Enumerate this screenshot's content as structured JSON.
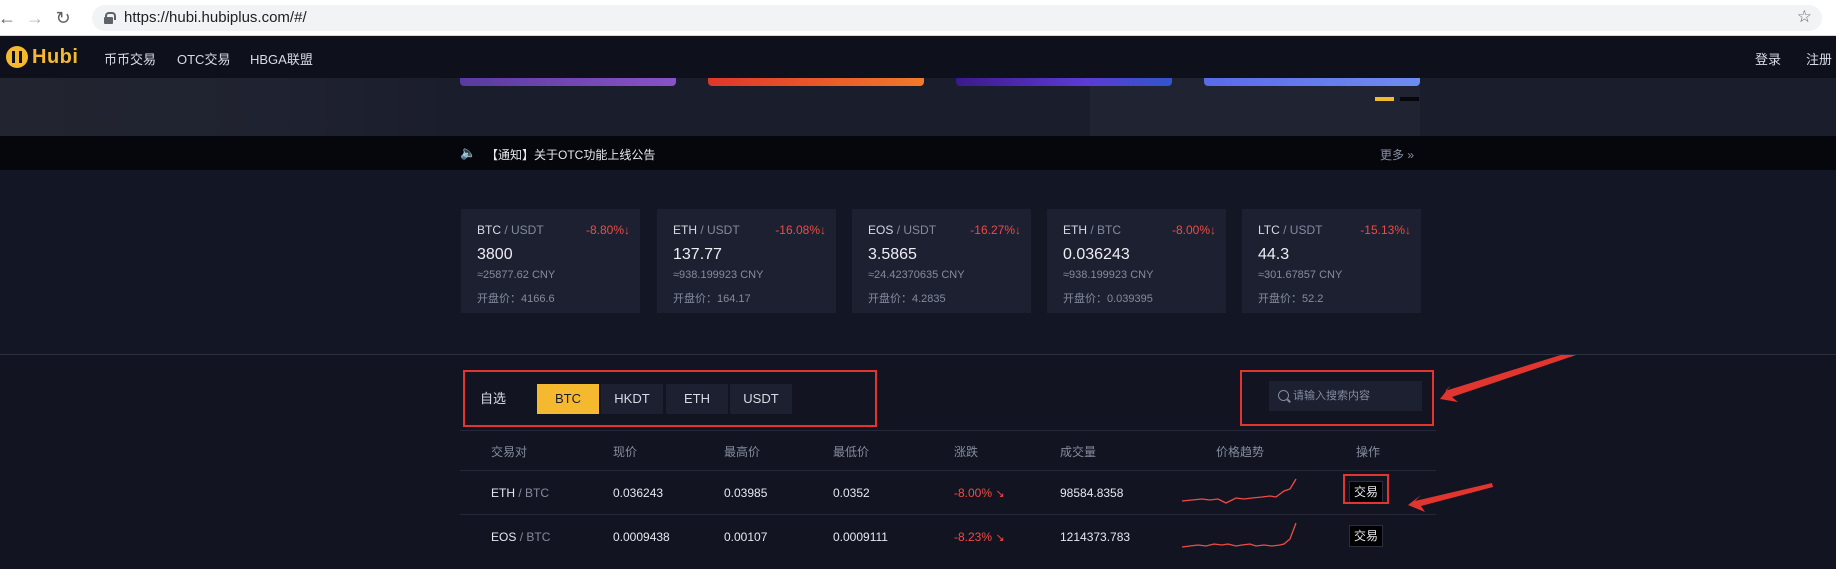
{
  "browser": {
    "url": "https://hubi.hubiplus.com/#/",
    "back_icon": "arrow-left-icon",
    "forward_icon": "arrow-right-icon",
    "reload_icon": "reload-icon",
    "bookmark_icon": "star-icon"
  },
  "header": {
    "logo": "Hubi",
    "nav": [
      "币币交易",
      "OTC交易",
      "HBGA联盟"
    ],
    "login": "登录",
    "register": "注册"
  },
  "notice": {
    "text": "【通知】关于OTC功能上线公告",
    "more": "更多"
  },
  "tickers": [
    {
      "base": "BTC",
      "quote": "/ USDT",
      "change": "-8.80%",
      "price": "3800",
      "cny": "≈25877.62 CNY",
      "open": "开盘价：4166.6"
    },
    {
      "base": "ETH",
      "quote": "/ USDT",
      "change": "-16.08%",
      "price": "137.77",
      "cny": "≈938.199923 CNY",
      "open": "开盘价：164.17"
    },
    {
      "base": "EOS",
      "quote": "/ USDT",
      "change": "-16.27%",
      "price": "3.5865",
      "cny": "≈24.42370635 CNY",
      "open": "开盘价：4.2835"
    },
    {
      "base": "ETH",
      "quote": "/ BTC",
      "change": "-8.00%",
      "price": "0.036243",
      "cny": "≈938.199923 CNY",
      "open": "开盘价：0.039395"
    },
    {
      "base": "LTC",
      "quote": "/ USDT",
      "change": "-15.13%",
      "price": "44.3",
      "cny": "≈301.67857 CNY",
      "open": "开盘价：52.2"
    }
  ],
  "market": {
    "tabs": [
      "自选",
      "BTC",
      "HKDT",
      "ETH",
      "USDT"
    ],
    "active_tab": "BTC",
    "search_placeholder": "请输入搜索内容",
    "columns": [
      "交易对",
      "现价",
      "最高价",
      "最低价",
      "涨跌",
      "成交量",
      "价格趋势",
      "操作"
    ],
    "rows": [
      {
        "base": "ETH",
        "quote": "/ BTC",
        "price": "0.036243",
        "high": "0.03985",
        "low": "0.0352",
        "change": "-8.00%",
        "volume": "98584.8358",
        "action": "交易"
      },
      {
        "base": "EOS",
        "quote": "/ BTC",
        "price": "0.0009438",
        "high": "0.00107",
        "low": "0.0009111",
        "change": "-8.23%",
        "volume": "1214373.783",
        "action": "交易"
      }
    ]
  },
  "colors": {
    "accent": "#f5b930",
    "down": "#ef4b45",
    "annotation": "#e3352f",
    "background": "#121521"
  }
}
